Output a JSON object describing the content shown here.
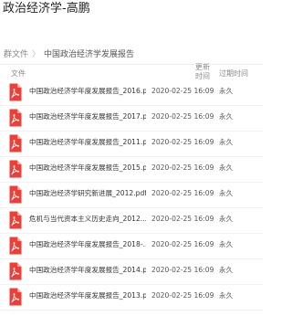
{
  "header": {
    "title": "政治经济学-高鹏"
  },
  "breadcrumb": {
    "root": "群文件",
    "separator": "〉",
    "current": "中国政治经济学发展报告"
  },
  "columns": {
    "name": "文件",
    "updated": "更新时间",
    "expire": "过期时间"
  },
  "colors": {
    "pdf_red": "#e8413b",
    "title_text": "#1f1f1f",
    "muted_text": "#8a8a8a"
  },
  "files": [
    {
      "name": "中国政治经济学年度发展报告_2016.p...",
      "date": "2020-02-25 16:09",
      "expire": "永久",
      "icon": "pdf-icon"
    },
    {
      "name": "中国政治经济学年度发展报告_2017.p...",
      "date": "2020-02-25 16:09",
      "expire": "永久",
      "icon": "pdf-icon"
    },
    {
      "name": "中国政治经济学年度发展报告_2011.p...",
      "date": "2020-02-25 16:09",
      "expire": "永久",
      "icon": "pdf-icon"
    },
    {
      "name": "中国政治经济学年度发展报告_2015.p...",
      "date": "2020-02-25 16:09",
      "expire": "永久",
      "icon": "pdf-icon"
    },
    {
      "name": "中国政治经济学研究新进展_2012.pdf",
      "date": "2020-02-25 16:09",
      "expire": "永久",
      "icon": "pdf-icon"
    },
    {
      "name": "危机与当代资本主义历史走向_2012....",
      "date": "2020-02-25 16:09",
      "expire": "永久",
      "icon": "pdf-icon"
    },
    {
      "name": "中国政治经济学年度发展报告_2018-...",
      "date": "2020-02-25 16:09",
      "expire": "永久",
      "icon": "pdf-icon"
    },
    {
      "name": "中国政治经济学年度发展报告_2014.p...",
      "date": "2020-02-25 16:09",
      "expire": "永久",
      "icon": "pdf-icon"
    },
    {
      "name": "中国政治经济学年度发展报告_2013.p...",
      "date": "2020-02-25 16:09",
      "expire": "永久",
      "icon": "pdf-icon"
    }
  ]
}
